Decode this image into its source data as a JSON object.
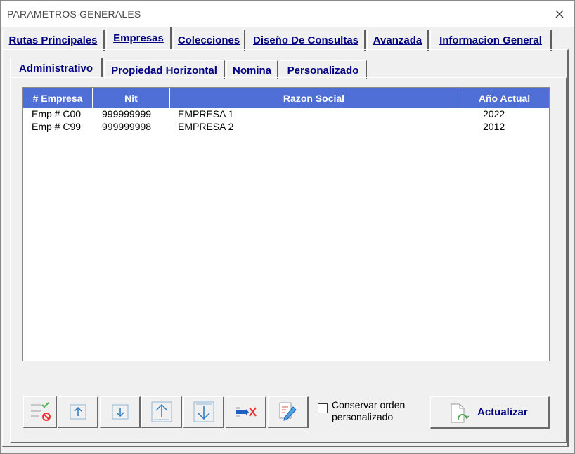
{
  "window": {
    "title": "PARAMETROS GENERALES"
  },
  "tabs": [
    {
      "label": "Rutas Principales"
    },
    {
      "label": "Empresas"
    },
    {
      "label": "Colecciones"
    },
    {
      "label": "Diseño De Consultas"
    },
    {
      "label": "Avanzada"
    },
    {
      "label": "Informacion General"
    }
  ],
  "active_tab": "Empresas",
  "subtabs": [
    {
      "label": "Administrativo"
    },
    {
      "label": "Propiedad Horizontal"
    },
    {
      "label": "Nomina"
    },
    {
      "label": "Personalizado"
    }
  ],
  "active_subtab": "Administrativo",
  "table": {
    "headers": [
      "# Empresa",
      "Nit",
      "Razon Social",
      "Año Actual"
    ],
    "rows": [
      [
        "Emp # C00",
        "999999999",
        "EMPRESA 1",
        "2022"
      ],
      [
        "Emp # C99",
        "999999998",
        "EMPRESA 2",
        "2012"
      ]
    ]
  },
  "toolbar": {
    "icons": [
      "select-exclude-icon",
      "move-up-icon",
      "move-down-icon",
      "move-top-icon",
      "move-bottom-icon",
      "delete-icon",
      "edit-icon"
    ]
  },
  "checkbox": {
    "label": "Conservar orden personalizado",
    "checked": false
  },
  "actualizar": {
    "label": "Actualizar"
  },
  "colors": {
    "header_bg": "#4f6fd6",
    "tab_text": "#000080",
    "panel_bg": "#f0f0f0"
  }
}
